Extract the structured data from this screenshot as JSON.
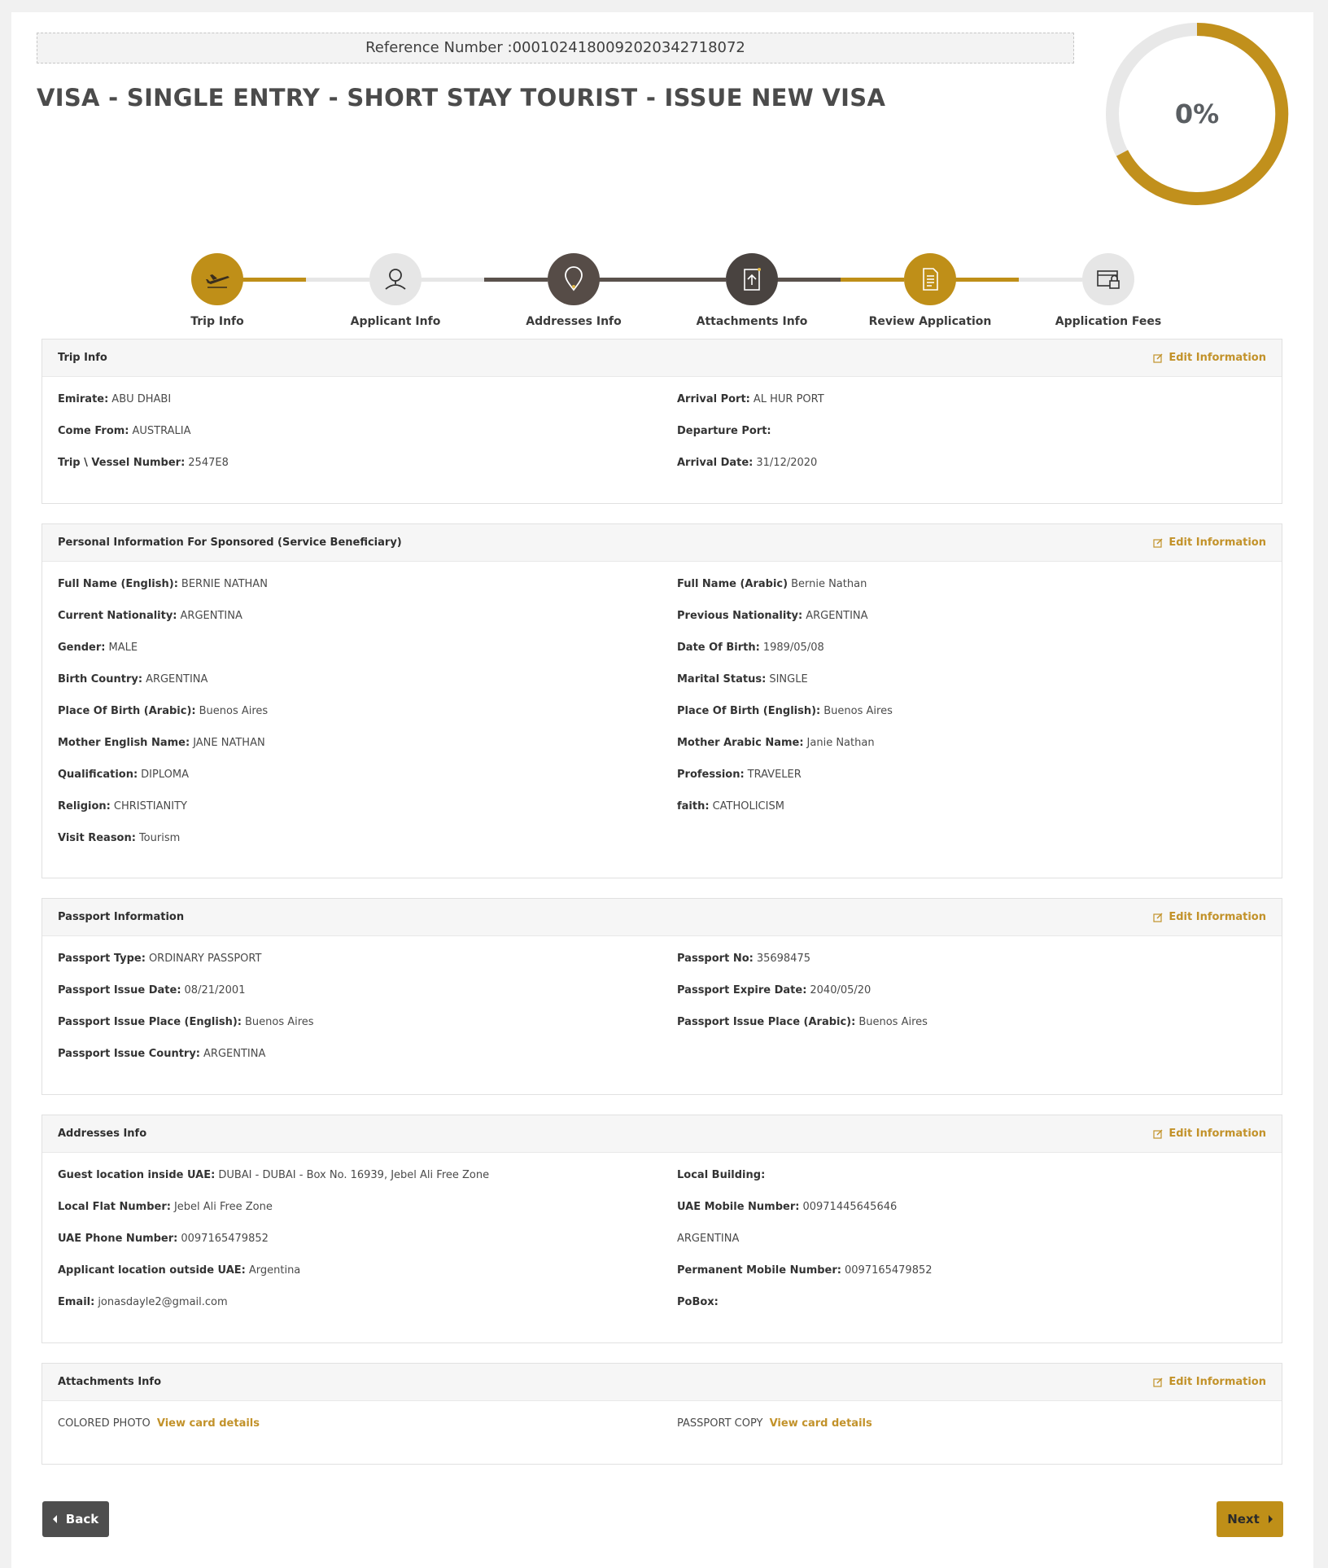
{
  "reference": {
    "label": "Reference Number :",
    "value": "0001024180092020342718072"
  },
  "title": "VISA - SINGLE ENTRY - SHORT STAY TOURIST - ISSUE NEW VISA",
  "progress": {
    "percent": 0,
    "text": "0%"
  },
  "colors": {
    "accent": "#bf8f18",
    "dark": "#4f4947",
    "light": "#e6e6e6"
  },
  "stepper": [
    {
      "label": "Trip Info",
      "icon": "plane-icon",
      "state": "active"
    },
    {
      "label": "Applicant Info",
      "icon": "user-pin-icon",
      "state": "pending"
    },
    {
      "label": "Addresses Info",
      "icon": "location-pin-icon",
      "state": "done"
    },
    {
      "label": "Attachments Info",
      "icon": "upload-document-icon",
      "state": "done"
    },
    {
      "label": "Review Application",
      "icon": "document-icon",
      "state": "active"
    },
    {
      "label": "Application Fees",
      "icon": "payment-lock-icon",
      "state": "pending"
    }
  ],
  "edit_label": "Edit Information",
  "sections": {
    "trip": {
      "title": "Trip Info",
      "emirate": {
        "label": "Emirate:",
        "value": "ABU DHABI"
      },
      "come_from": {
        "label": "Come From:",
        "value": "AUSTRALIA"
      },
      "vessel": {
        "label": "Trip \\ Vessel Number:",
        "value": "2547E8"
      },
      "arrival_port": {
        "label": "Arrival Port:",
        "value": "AL HUR PORT"
      },
      "departure_port": {
        "label": "Departure Port:",
        "value": ""
      },
      "arrival_date": {
        "label": "Arrival Date:",
        "value": "31/12/2020"
      }
    },
    "personal": {
      "title": "Personal Information For Sponsored (Service Beneficiary)",
      "full_name_en": {
        "label": "Full Name (English):",
        "value": "BERNIE NATHAN"
      },
      "full_name_ar": {
        "label": "Full Name (Arabic)",
        "value": "Bernie Nathan"
      },
      "current_nationality": {
        "label": "Current Nationality:",
        "value": "ARGENTINA"
      },
      "previous_nationality": {
        "label": "Previous Nationality:",
        "value": "ARGENTINA"
      },
      "gender": {
        "label": "Gender:",
        "value": "MALE"
      },
      "dob": {
        "label": "Date Of Birth:",
        "value": "1989/05/08"
      },
      "birth_country": {
        "label": "Birth Country:",
        "value": "ARGENTINA"
      },
      "marital_status": {
        "label": "Marital Status:",
        "value": "SINGLE"
      },
      "pob_ar": {
        "label": "Place Of Birth (Arabic):",
        "value": "Buenos Aires"
      },
      "pob_en": {
        "label": "Place Of Birth (English):",
        "value": "Buenos Aires"
      },
      "mother_en": {
        "label": "Mother English Name:",
        "value": "JANE NATHAN"
      },
      "mother_ar": {
        "label": "Mother Arabic Name:",
        "value": "Janie Nathan"
      },
      "qualification": {
        "label": "Qualification:",
        "value": "DIPLOMA"
      },
      "profession": {
        "label": "Profession:",
        "value": "TRAVELER"
      },
      "religion": {
        "label": "Religion:",
        "value": "CHRISTIANITY"
      },
      "faith": {
        "label": "faith:",
        "value": "CATHOLICISM"
      },
      "visit_reason": {
        "label": "Visit Reason:",
        "value": "Tourism"
      }
    },
    "passport": {
      "title": "Passport Information",
      "type": {
        "label": "Passport Type:",
        "value": "ORDINARY PASSPORT"
      },
      "number": {
        "label": "Passport No:",
        "value": "35698475"
      },
      "issue_date": {
        "label": "Passport Issue Date:",
        "value": "08/21/2001"
      },
      "expire_date": {
        "label": "Passport Expire Date:",
        "value": "2040/05/20"
      },
      "issue_place_en": {
        "label": "Passport Issue Place (English):",
        "value": "Buenos Aires"
      },
      "issue_place_ar": {
        "label": "Passport Issue Place (Arabic):",
        "value": "Buenos Aires"
      },
      "issue_country": {
        "label": "Passport Issue Country:",
        "value": "ARGENTINA"
      }
    },
    "addresses": {
      "title": "Addresses Info",
      "guest_location": {
        "label": "Guest location inside UAE:",
        "value": "DUBAI - DUBAI - Box No. 16939, Jebel Ali Free Zone"
      },
      "local_building": {
        "label": "Local Building:",
        "value": ""
      },
      "local_flat": {
        "label": "Local Flat Number:",
        "value": "Jebel Ali Free Zone"
      },
      "uae_mobile": {
        "label": "UAE Mobile Number:",
        "value": "00971445645646"
      },
      "uae_phone": {
        "label": "UAE Phone Number:",
        "value": "0097165479852"
      },
      "country_line": "ARGENTINA",
      "outside_location": {
        "label": "Applicant location outside UAE:",
        "value": "Argentina"
      },
      "permanent_mobile": {
        "label": "Permanent Mobile Number:",
        "value": "0097165479852"
      },
      "email": {
        "label": "Email:",
        "value": "jonasdayle2@gmail.com"
      },
      "pobox": {
        "label": "PoBox:",
        "value": ""
      }
    },
    "attachments": {
      "title": "Attachments Info",
      "photo": {
        "label": "COLORED PHOTO",
        "link": "View card details"
      },
      "passport_copy": {
        "label": "PASSPORT COPY",
        "link": "View card details"
      }
    }
  },
  "buttons": {
    "back": "Back",
    "next": "Next"
  }
}
